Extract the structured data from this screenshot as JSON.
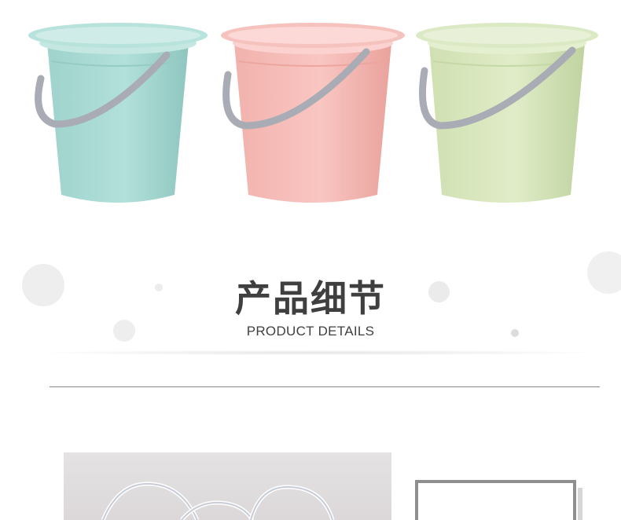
{
  "section_title": {
    "cn": "产品细节",
    "en": "PRODUCT DETAILS"
  },
  "products": [
    {
      "name": "teal-bucket",
      "color": "#a7d9d2",
      "shade": "#8fc8c1"
    },
    {
      "name": "pink-bucket",
      "color": "#f6bcb8",
      "shade": "#eda29d"
    },
    {
      "name": "green-bucket",
      "color": "#d8e6bd",
      "shade": "#c3d6a3"
    }
  ],
  "colors": {
    "handle": "#a9acb5",
    "text": "#3f3f3f",
    "divider": "#8a8a8a"
  }
}
